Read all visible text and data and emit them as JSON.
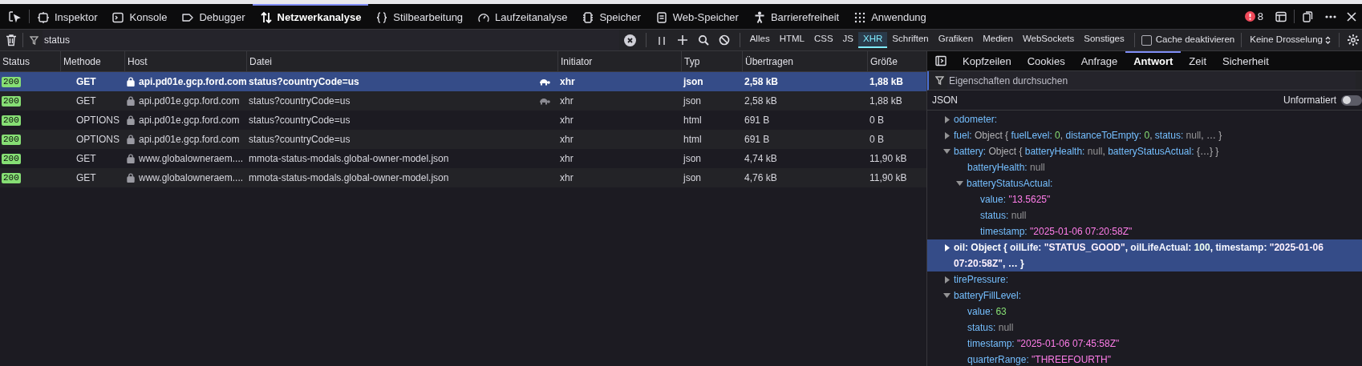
{
  "toolbar": {
    "tabs": [
      {
        "label": "Inspektor",
        "selected": false
      },
      {
        "label": "Konsole",
        "selected": false
      },
      {
        "label": "Debugger",
        "selected": false
      },
      {
        "label": "Netzwerkanalyse",
        "selected": true
      },
      {
        "label": "Stilbearbeitung",
        "selected": false
      },
      {
        "label": "Laufzeitanalyse",
        "selected": false
      },
      {
        "label": "Speicher",
        "selected": false
      },
      {
        "label": "Web-Speicher",
        "selected": false
      },
      {
        "label": "Barrierefreiheit",
        "selected": false
      },
      {
        "label": "Anwendung",
        "selected": false
      }
    ],
    "error_count": "8"
  },
  "filter_bar": {
    "filter_value": "status",
    "type_filters": [
      {
        "label": "Alles",
        "selected": false
      },
      {
        "label": "HTML",
        "selected": false
      },
      {
        "label": "CSS",
        "selected": false
      },
      {
        "label": "JS",
        "selected": false
      },
      {
        "label": "XHR",
        "selected": true
      },
      {
        "label": "Schriften",
        "selected": false
      },
      {
        "label": "Grafiken",
        "selected": false
      },
      {
        "label": "Medien",
        "selected": false
      },
      {
        "label": "WebSockets",
        "selected": false
      },
      {
        "label": "Sonstiges",
        "selected": false
      }
    ],
    "cache_disabled": {
      "label": "Cache deaktivieren",
      "checked": false
    },
    "throttling": "Keine Drosselung"
  },
  "table": {
    "columns": [
      "Status",
      "Methode",
      "Host",
      "Datei",
      "Initiator",
      "Typ",
      "Übertragen",
      "Größe"
    ],
    "rows": [
      {
        "status": "200",
        "method": "GET",
        "host": "api.pd01e.gcp.ford.com",
        "file": "status?countryCode=us",
        "turtle_icon": true,
        "initiator": "xhr",
        "type": "json",
        "transferred": "2,58 kB",
        "size": "1,88 kB",
        "selected": true
      },
      {
        "status": "200",
        "method": "GET",
        "host": "api.pd01e.gcp.ford.com",
        "file": "status?countryCode=us",
        "turtle_icon": true,
        "initiator": "xhr",
        "type": "json",
        "transferred": "2,58 kB",
        "size": "1,88 kB",
        "selected": false
      },
      {
        "status": "200",
        "method": "OPTIONS",
        "host": "api.pd01e.gcp.ford.com",
        "file": "status?countryCode=us",
        "turtle_icon": false,
        "initiator": "xhr",
        "type": "html",
        "transferred": "691 B",
        "size": "0 B",
        "selected": false
      },
      {
        "status": "200",
        "method": "OPTIONS",
        "host": "api.pd01e.gcp.ford.com",
        "file": "status?countryCode=us",
        "turtle_icon": false,
        "initiator": "xhr",
        "type": "html",
        "transferred": "691 B",
        "size": "0 B",
        "selected": false
      },
      {
        "status": "200",
        "method": "GET",
        "host": "www.globalowneraem....",
        "file": "mmota-status-modals.global-owner-model.json",
        "turtle_icon": false,
        "initiator": "xhr",
        "type": "json",
        "transferred": "4,74 kB",
        "size": "11,90 kB",
        "selected": false
      },
      {
        "status": "200",
        "method": "GET",
        "host": "www.globalowneraem....",
        "file": "mmota-status-modals.global-owner-model.json",
        "turtle_icon": false,
        "initiator": "xhr",
        "type": "json",
        "transferred": "4,76 kB",
        "size": "11,90 kB",
        "selected": false
      }
    ]
  },
  "details": {
    "tabs": [
      {
        "label": "Kopfzeilen",
        "selected": false
      },
      {
        "label": "Cookies",
        "selected": false
      },
      {
        "label": "Anfrage",
        "selected": false
      },
      {
        "label": "Antwort",
        "selected": true
      },
      {
        "label": "Zeit",
        "selected": false
      },
      {
        "label": "Sicherheit",
        "selected": false
      }
    ],
    "filter_placeholder": "Eigenschaften durchsuchen",
    "format_label": "JSON",
    "raw_toggle": {
      "label": "Unformatiert",
      "on": false
    },
    "tree": [
      {
        "key": "odometer:",
        "expanded": false,
        "selected": false
      },
      {
        "key": "fuel:",
        "expanded": false,
        "selected": false,
        "value": [
          {
            "kind": "text",
            "text": "Object { "
          },
          {
            "kind": "key",
            "text": "fuelLevel: "
          },
          {
            "kind": "number",
            "text": "0"
          },
          {
            "kind": "text",
            "text": ", "
          },
          {
            "kind": "key",
            "text": "distanceToEmpty: "
          },
          {
            "kind": "number",
            "text": "0"
          },
          {
            "kind": "text",
            "text": ", "
          },
          {
            "kind": "key",
            "text": "status: "
          },
          {
            "kind": "null",
            "text": "null"
          },
          {
            "kind": "text",
            "text": ", … }"
          }
        ]
      },
      {
        "key": "battery:",
        "expanded": true,
        "selected": false,
        "value": [
          {
            "kind": "text",
            "text": "Object { "
          },
          {
            "kind": "key",
            "text": "batteryHealth: "
          },
          {
            "kind": "null",
            "text": "null"
          },
          {
            "kind": "text",
            "text": ", "
          },
          {
            "kind": "key",
            "text": "batteryStatusActual: "
          },
          {
            "kind": "text",
            "text": "{…} }"
          }
        ],
        "children": [
          {
            "key": "batteryHealth:",
            "selected": false,
            "value": [
              {
                "kind": "null",
                "text": "null"
              }
            ]
          },
          {
            "key": "batteryStatusActual:",
            "expanded": true,
            "selected": false,
            "children": [
              {
                "key": "value:",
                "selected": false,
                "value": [
                  {
                    "kind": "string",
                    "text": "\"13.5625\""
                  }
                ]
              },
              {
                "key": "status:",
                "selected": false,
                "value": [
                  {
                    "kind": "null",
                    "text": "null"
                  }
                ]
              },
              {
                "key": "timestamp:",
                "selected": false,
                "value": [
                  {
                    "kind": "string",
                    "text": "\"2025-01-06 07:20:58Z\""
                  }
                ]
              }
            ]
          }
        ]
      },
      {
        "key": "oil:",
        "expanded": false,
        "selected": true,
        "value": [
          {
            "kind": "text",
            "text": "Object { "
          },
          {
            "kind": "key",
            "text": "oilLife: "
          },
          {
            "kind": "string",
            "text": "\"STATUS_GOOD\""
          },
          {
            "kind": "text",
            "text": ", "
          },
          {
            "kind": "key",
            "text": "oilLifeActual: "
          },
          {
            "kind": "number",
            "text": "100"
          },
          {
            "kind": "text",
            "text": ", "
          },
          {
            "kind": "key",
            "text": "timestamp: "
          },
          {
            "kind": "string",
            "text": "\"2025-01-06 07:20:58Z\""
          },
          {
            "kind": "text",
            "text": ", … }"
          }
        ]
      },
      {
        "key": "tirePressure:",
        "expanded": false,
        "selected": false
      },
      {
        "key": "batteryFillLevel:",
        "expanded": true,
        "selected": false,
        "children": [
          {
            "key": "value:",
            "selected": false,
            "value": [
              {
                "kind": "number",
                "text": "63"
              }
            ]
          },
          {
            "key": "status:",
            "selected": false,
            "value": [
              {
                "kind": "null",
                "text": "null"
              }
            ]
          },
          {
            "key": "timestamp:",
            "selected": false,
            "value": [
              {
                "kind": "string",
                "text": "\"2025-01-06 07:45:58Z\""
              }
            ]
          },
          {
            "key": "quarterRange:",
            "selected": false,
            "value": [
              {
                "kind": "string",
                "text": "\"THREEFOURTH\""
              }
            ]
          }
        ]
      }
    ]
  }
}
